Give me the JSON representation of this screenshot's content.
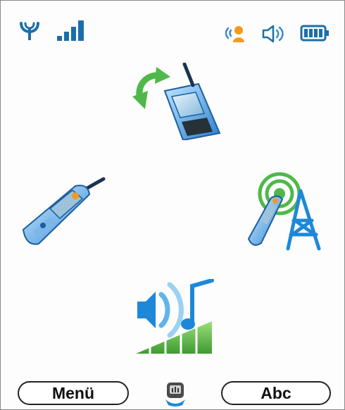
{
  "status_bar": {
    "icons": [
      "antenna-icon",
      "signal-strength-icon",
      "call-indicator-icon",
      "speaker-icon",
      "battery-icon"
    ],
    "signal_bars": 4,
    "battery_level": 1.0
  },
  "menu": {
    "items": [
      {
        "icon": "phone-sync-icon",
        "position": "top"
      },
      {
        "icon": "mobile-phone-icon",
        "position": "left"
      },
      {
        "icon": "network-tower-icon",
        "position": "right"
      },
      {
        "icon": "sound-volume-icon",
        "position": "bottom"
      }
    ]
  },
  "softkeys": {
    "left_label": "Menü",
    "right_label": "Abc",
    "center_icon": "navigation-key-icon"
  },
  "colors": {
    "accent_blue": "#1e88d8",
    "accent_green": "#4fb84a",
    "orange": "#f39a1e"
  }
}
